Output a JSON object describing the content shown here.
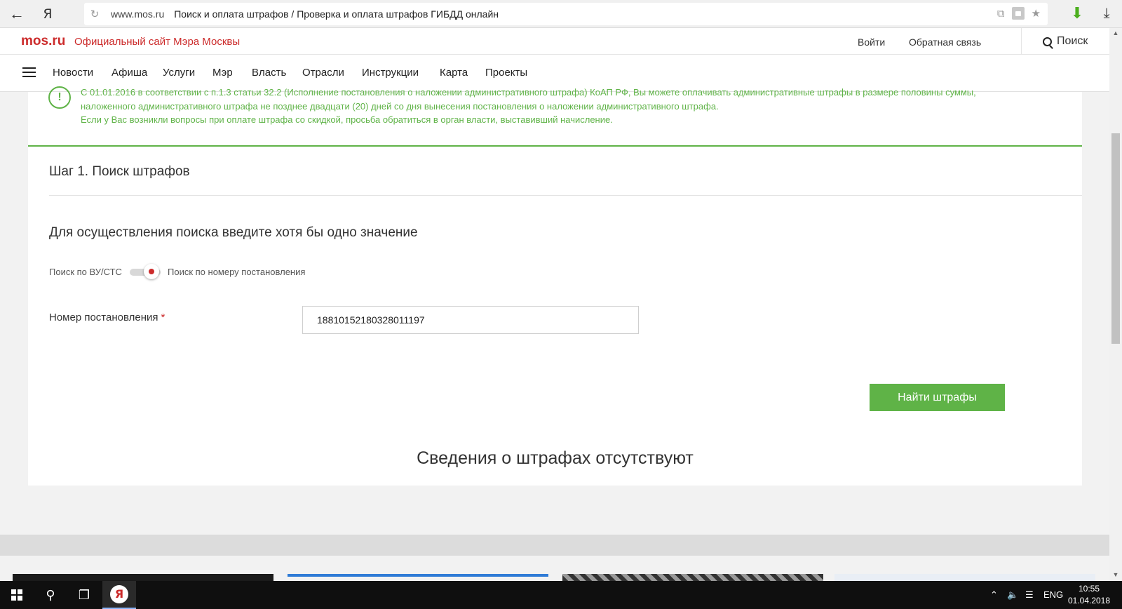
{
  "browser": {
    "url_domain": "www.mos.ru",
    "page_title": "Поиск и оплата штрафов / Проверка и оплата штрафов ГИБДД онлайн",
    "ya_label": "Я"
  },
  "site_header": {
    "logo": "mos.ru",
    "slogan": "Официальный сайт Мэра Москвы",
    "login": "Войти",
    "feedback": "Обратная связь",
    "search": "Поиск"
  },
  "nav": {
    "items": [
      "Новости",
      "Афиша",
      "Услуги",
      "Мэр",
      "Власть",
      "Отрасли",
      "Инструкции",
      "Карта",
      "Проекты"
    ]
  },
  "notice": {
    "line1": "С 01.01.2016 в соответствии с п.1.3 статьи 32.2 (Исполнение постановления о наложении административного штрафа) КоАП РФ, Вы можете оплачивать административные штрафы в размере половины суммы,",
    "line2": "наложенного административного штрафа не позднее двадцати (20) дней со дня вынесения постановления о наложении административного штрафа.",
    "line3": "Если у Вас возникли вопросы при оплате штрафа со скидкой, просьба обратиться в орган власти, выставивший начисление."
  },
  "step": {
    "title": "Шаг 1. Поиск штрафов",
    "prompt": "Для осуществления поиска введите хотя бы одно значение"
  },
  "toggle": {
    "left_label": "Поиск по ВУ/СТС",
    "right_label": "Поиск по номеру постановления"
  },
  "form": {
    "field_label": "Номер постановления",
    "required_mark": "*",
    "field_value": "18810152180328011197",
    "submit_label": "Найти штрафы"
  },
  "result": {
    "message": "Сведения о штрафах отсутствуют"
  },
  "taskbar": {
    "language": "ENG",
    "time": "10:55",
    "date": "01.04.2018"
  },
  "colors": {
    "brand_red": "#cc2b2b",
    "accent_green": "#5fb347"
  }
}
